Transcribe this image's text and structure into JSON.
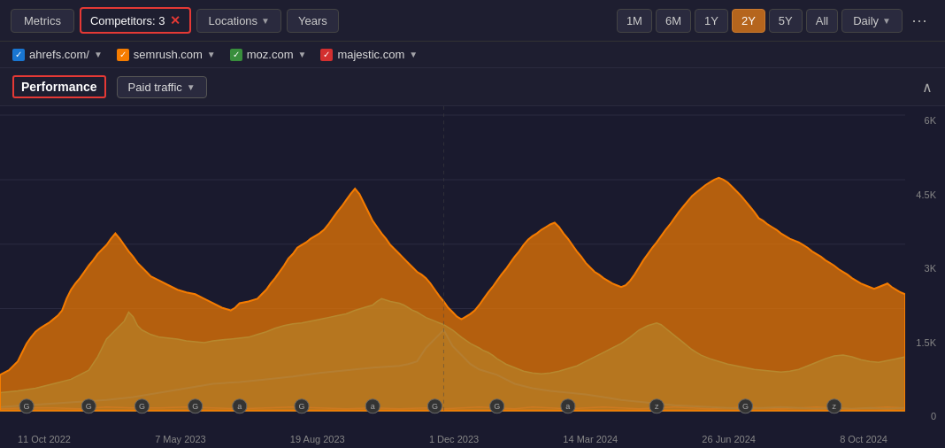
{
  "toolbar": {
    "metrics_label": "Metrics",
    "competitors_label": "Competitors: 3",
    "locations_label": "Locations",
    "years_label": "Years",
    "time_buttons": [
      "1M",
      "6M",
      "1Y",
      "2Y",
      "5Y",
      "All"
    ],
    "active_time": "2Y",
    "daily_label": "Daily",
    "more_icon": "⋯"
  },
  "competitors": [
    {
      "name": "ahrefs.com/",
      "color_class": "cb-blue",
      "check": "✓"
    },
    {
      "name": "semrush.com",
      "color_class": "cb-orange",
      "check": "✓"
    },
    {
      "name": "moz.com",
      "color_class": "cb-green",
      "check": "✓"
    },
    {
      "name": "majestic.com",
      "color_class": "cb-red",
      "check": "✓"
    }
  ],
  "performance": {
    "label": "Performance",
    "metric_label": "Paid traffic",
    "collapse_icon": "∧"
  },
  "y_axis": [
    "6K",
    "4.5K",
    "3K",
    "1.5K",
    "0"
  ],
  "x_axis": [
    "11 Oct 2022",
    "7 May 2023",
    "19 Aug 2023",
    "1 Dec 2023",
    "14 Mar 2024",
    "26 Jun 2024",
    "8 Oct 2024"
  ],
  "colors": {
    "orange": "#f57c00",
    "green": "#26a69a",
    "blue": "#1565c0",
    "red": "#e53935",
    "bg": "#1a1a2e"
  }
}
